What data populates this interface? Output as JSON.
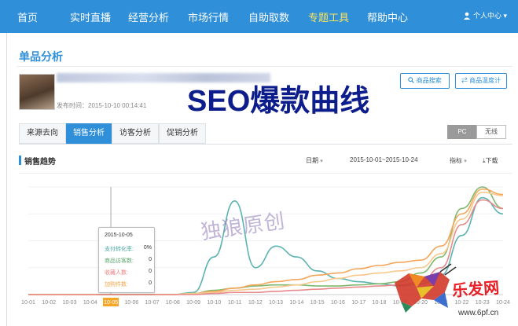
{
  "nav": {
    "items": [
      "首页",
      "实时直播",
      "经营分析",
      "市场行情",
      "自助取数",
      "专题工具",
      "帮助中心"
    ],
    "active": "专题工具",
    "user_label": "个人中心"
  },
  "page": {
    "title": "单品分析",
    "publish_time": "发布时间：2015-10-10 00:14:41",
    "search_button": "商品搜索",
    "temp_button": "商品温度计"
  },
  "overlay": {
    "seo_text": "SEO爆款曲线",
    "watermark": "独狼原创",
    "logo_text": "乐发网",
    "logo_url": "www.6pf.cn"
  },
  "tabs": [
    "来源去向",
    "销售分析",
    "访客分析",
    "促销分析"
  ],
  "device_toggle": [
    "PC",
    "无线"
  ],
  "section": {
    "title": "销售趋势",
    "date_label": "日期",
    "date_range": "2015-10-01~2015-10-24",
    "metric_label": "指标",
    "download_label": "下载"
  },
  "tooltip": {
    "date": "2015-10-05",
    "rows": [
      {
        "label": "支付转化率:",
        "value": "0%",
        "color": "#4aa9a4"
      },
      {
        "label": "商品访客数:",
        "value": "0",
        "color": "#5aa86c"
      },
      {
        "label": "收藏人数:",
        "value": "0",
        "color": "#f08080"
      },
      {
        "label": "加购件数:",
        "value": "0",
        "color": "#f2a64a"
      }
    ]
  },
  "chart_data": {
    "type": "line",
    "categories": [
      "10-01",
      "10-02",
      "10-03",
      "10-04",
      "10-05",
      "10-06",
      "10-07",
      "10-08",
      "10-09",
      "10-10",
      "10-11",
      "10-12",
      "10-13",
      "10-14",
      "10-15",
      "10-16",
      "10-17",
      "10-18",
      "10-19",
      "10-20",
      "10-21",
      "10-22",
      "10-23",
      "10-24"
    ],
    "highlight_category": "10-05",
    "ylim": [
      0,
      100
    ],
    "grid": true,
    "series": [
      {
        "color": "#5bb3b0",
        "values": [
          0,
          0,
          0,
          0,
          0,
          0,
          0,
          0,
          2,
          35,
          87,
          25,
          45,
          35,
          22,
          15,
          12,
          10,
          8,
          10,
          18,
          55,
          90,
          75
        ]
      },
      {
        "color": "#7fb86f",
        "values": [
          0,
          0,
          0,
          0,
          0,
          0,
          0,
          0,
          1,
          4,
          6,
          8,
          9,
          9,
          8,
          8,
          9,
          10,
          12,
          20,
          35,
          80,
          100,
          80
        ]
      },
      {
        "color": "#f5a65b",
        "values": [
          0,
          0,
          0,
          0,
          0,
          0,
          0,
          0,
          1,
          3,
          6,
          9,
          12,
          14,
          18,
          20,
          24,
          27,
          30,
          32,
          45,
          75,
          98,
          93
        ]
      },
      {
        "color": "#f9c88c",
        "values": [
          0,
          0,
          0,
          0,
          0,
          0,
          0,
          0,
          1,
          2,
          4,
          5,
          7,
          9,
          12,
          15,
          18,
          20,
          22,
          25,
          38,
          70,
          95,
          92
        ]
      },
      {
        "color": "#e88a8a",
        "values": [
          0,
          0,
          0,
          0,
          0,
          0,
          0,
          0,
          0,
          1,
          2,
          2,
          3,
          4,
          5,
          6,
          7,
          8,
          9,
          12,
          25,
          65,
          88,
          80
        ]
      }
    ]
  },
  "colors": {
    "nav_bg": "#2f8fd8",
    "nav_active": "#ffe45c",
    "accent": "#2f8fd8"
  }
}
